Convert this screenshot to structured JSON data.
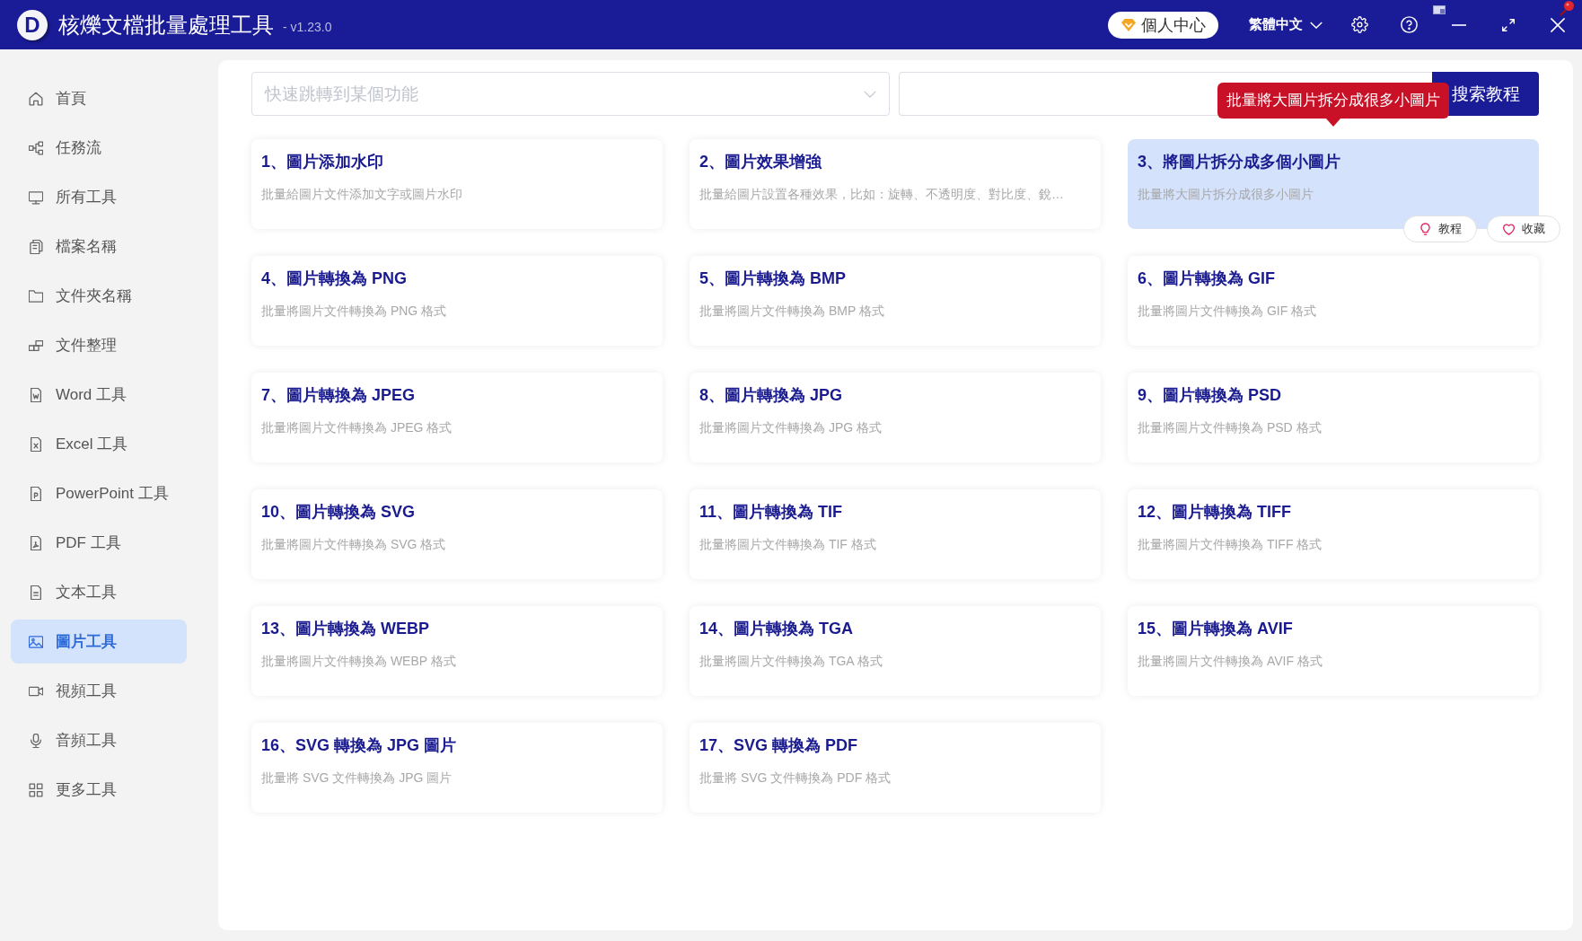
{
  "window": {
    "logo": "D",
    "title": "核爍文檔批量處理工具",
    "version": "- v1.23.0"
  },
  "header": {
    "account_button": "個人中心",
    "language": "繁體中文"
  },
  "sidebar": {
    "items": [
      {
        "label": "首頁",
        "selected": false
      },
      {
        "label": "任務流",
        "selected": false
      },
      {
        "label": "所有工具",
        "selected": false
      },
      {
        "label": "檔案名稱",
        "selected": false
      },
      {
        "label": "文件夾名稱",
        "selected": false
      },
      {
        "label": "文件整理",
        "selected": false
      },
      {
        "label": "Word 工具",
        "selected": false
      },
      {
        "label": "Excel 工具",
        "selected": false
      },
      {
        "label": "PowerPoint 工具",
        "selected": false
      },
      {
        "label": "PDF 工具",
        "selected": false
      },
      {
        "label": "文本工具",
        "selected": false
      },
      {
        "label": "圖片工具",
        "selected": true
      },
      {
        "label": "視頻工具",
        "selected": false
      },
      {
        "label": "音頻工具",
        "selected": false
      },
      {
        "label": "更多工具",
        "selected": false
      }
    ]
  },
  "search": {
    "jump_placeholder": "快速跳轉到某個功能",
    "button": "搜索教程"
  },
  "cards": [
    {
      "title": "1、圖片添加水印",
      "description": "批量給圖片文件添加文字或圖片水印",
      "highlighted": false
    },
    {
      "title": "2、圖片效果增強",
      "description": "批量給圖片設置各種效果，比如：旋轉、不透明度、對比度、銳…",
      "highlighted": false
    },
    {
      "title": "3、將圖片拆分成多個小圖片",
      "description": "批量將大圖片拆分成很多小圖片",
      "highlighted": true
    },
    {
      "title": "4、圖片轉換為 PNG",
      "description": "批量將圖片文件轉換為 PNG 格式",
      "highlighted": false
    },
    {
      "title": "5、圖片轉換為 BMP",
      "description": "批量將圖片文件轉換為 BMP 格式",
      "highlighted": false
    },
    {
      "title": "6、圖片轉換為 GIF",
      "description": "批量將圖片文件轉換為 GIF 格式",
      "highlighted": false
    },
    {
      "title": "7、圖片轉換為 JPEG",
      "description": "批量將圖片文件轉換為 JPEG 格式",
      "highlighted": false
    },
    {
      "title": "8、圖片轉換為 JPG",
      "description": "批量將圖片文件轉換為 JPG 格式",
      "highlighted": false
    },
    {
      "title": "9、圖片轉換為 PSD",
      "description": "批量將圖片文件轉換為 PSD 格式",
      "highlighted": false
    },
    {
      "title": "10、圖片轉換為 SVG",
      "description": "批量將圖片文件轉換為 SVG 格式",
      "highlighted": false
    },
    {
      "title": "11、圖片轉換為 TIF",
      "description": "批量將圖片文件轉換為 TIF 格式",
      "highlighted": false
    },
    {
      "title": "12、圖片轉換為 TIFF",
      "description": "批量將圖片文件轉換為 TIFF 格式",
      "highlighted": false
    },
    {
      "title": "13、圖片轉換為 WEBP",
      "description": "批量將圖片文件轉換為 WEBP 格式",
      "highlighted": false
    },
    {
      "title": "14、圖片轉換為 TGA",
      "description": "批量將圖片文件轉換為 TGA 格式",
      "highlighted": false
    },
    {
      "title": "15、圖片轉換為 AVIF",
      "description": "批量將圖片文件轉換為 AVIF 格式",
      "highlighted": false
    },
    {
      "title": "16、SVG 轉換為 JPG 圖片",
      "description": "批量將 SVG 文件轉換為 JPG 圖片",
      "highlighted": false
    },
    {
      "title": "17、SVG 轉換為 PDF",
      "description": "批量將 SVG 文件轉換為 PDF 格式",
      "highlighted": false
    }
  ],
  "tooltip": "批量將大圖片拆分成很多小圖片",
  "card_actions": [
    "教程",
    "收藏"
  ]
}
